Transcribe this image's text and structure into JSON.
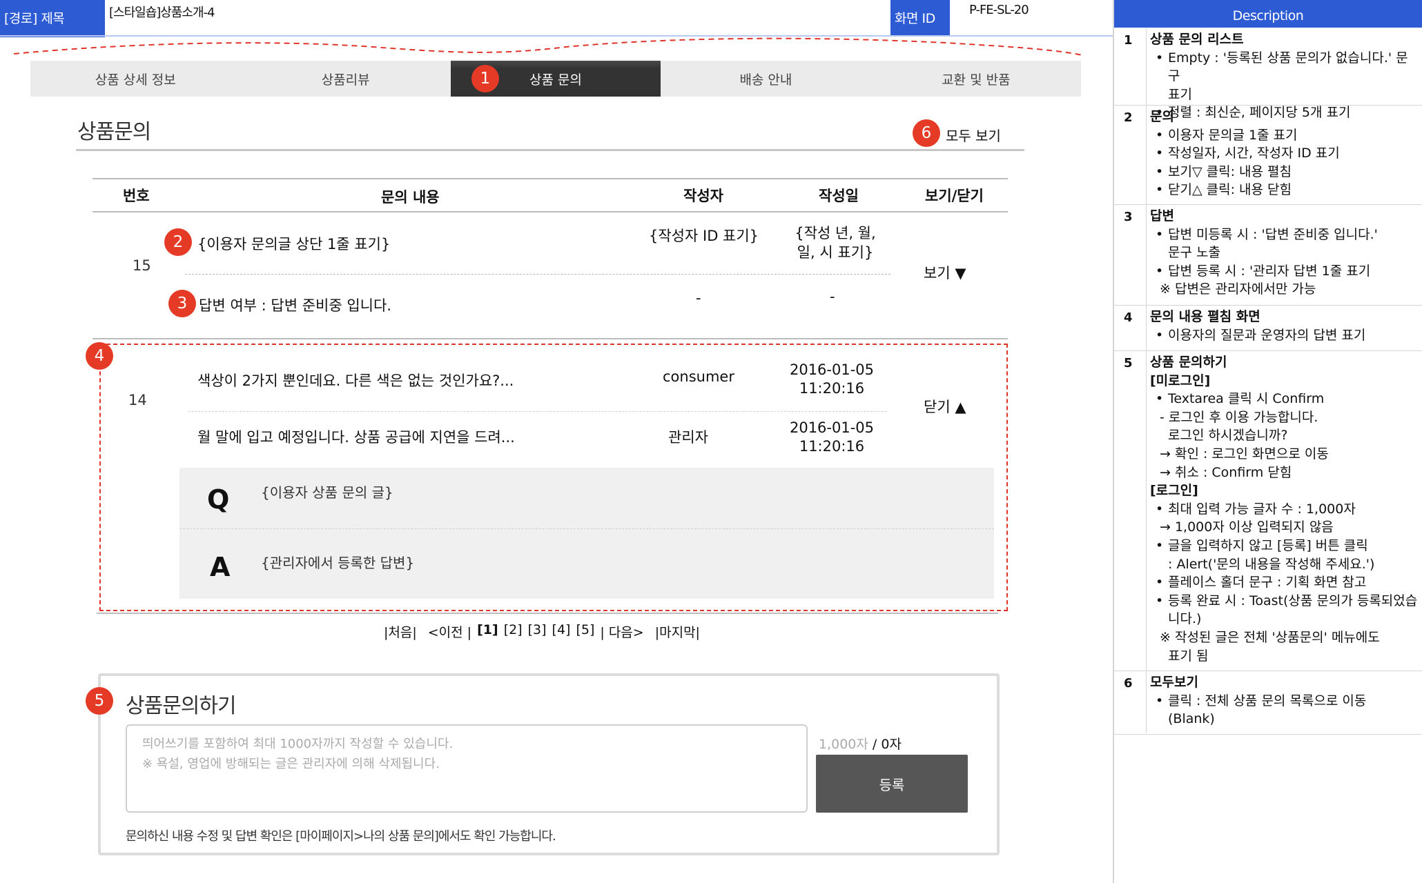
{
  "header": {
    "route_label": "[경로] 제목",
    "route_value": "[스타일숍]상품소개-4",
    "screen_id_label": "화면 ID",
    "screen_id_value": "P-FE-SL-20"
  },
  "tabs": [
    {
      "label": "상품 상세 정보"
    },
    {
      "label": "상품리뷰"
    },
    {
      "label": "상품 문의"
    },
    {
      "label": "배송 안내"
    },
    {
      "label": "교환 및 반품"
    }
  ],
  "badges": [
    "1",
    "2",
    "3",
    "4",
    "5",
    "6"
  ],
  "inquiry": {
    "title": "상품문의",
    "view_all": "모두 보기",
    "columns": [
      "번호",
      "문의 내용",
      "작성자",
      "작성일",
      "보기/닫기"
    ],
    "row15": {
      "num": "15",
      "question": "{이용자 문의글 상단 1줄 표기}",
      "author": "{작성자 ID 표기}",
      "date_line1": "{작성 년, 월,",
      "date_line2": "일, 시 표기}",
      "answer": "답변 여부 : 답변 준비중 입니다.",
      "answer_author": "-",
      "answer_date": "-",
      "toggle": "보기 ▼"
    },
    "row14": {
      "num": "14",
      "question": "색상이 2가지 뿐인데요. 다른 색은 없는 것인가요?...",
      "author": "consumer",
      "date": "2016-01-05",
      "time": "11:20:16",
      "answer": "월 말에 입고 예정입니다. 상품 공급에 지연을 드려...",
      "answer_author": "관리자",
      "answer_date": "2016-01-05",
      "answer_time": "11:20:16",
      "toggle": "닫기 ▲",
      "q_mark": "Q",
      "q_text": "{이용자 상품 문의 글}",
      "a_mark": "A",
      "a_text": "{관리자에서 등록한 답변}"
    },
    "pagination": {
      "first": "|처음|",
      "prev": "<이전 |",
      "pages": [
        "[1]",
        "[2]",
        "[3]",
        "[4]",
        "[5]"
      ],
      "next": "| 다음>",
      "last": "|마지막|"
    }
  },
  "write": {
    "title": "상품문의하기",
    "placeholder_line1": "띄어쓰기를 포함하여 최대 1000자까지 작성할 수 있습니다.",
    "placeholder_line2": "※ 욕설, 영업에 방해되는 글은 관리자에 의해 삭제됩니다.",
    "counter_max": "1,000자",
    "counter_current": " / 0자",
    "submit": "등록",
    "notice": "문의하신 내용 수정 및 답변 확인은 [마이페이지>나의 상품 문의]에서도 확인 가능합니다."
  },
  "description": {
    "title": "Description",
    "items": [
      {
        "num": "1",
        "lines": [
          {
            "k": "t",
            "v": "상품 문의 리스트"
          },
          {
            "k": "li",
            "v": "Empty : '등록된 상품 문의가 없습니다.' 문구"
          },
          {
            "k": "ind",
            "v": "표기"
          },
          {
            "k": "li",
            "v": "정렬 : 최신순, 페이지당 5개 표기"
          }
        ]
      },
      {
        "num": "2",
        "lines": [
          {
            "k": "t",
            "v": "문의"
          },
          {
            "k": "li",
            "v": "이용자 문의글 1줄 표기"
          },
          {
            "k": "li",
            "v": "작성일자, 시간, 작성자 ID 표기"
          },
          {
            "k": "li",
            "v": "보기▽ 클릭: 내용 펼침"
          },
          {
            "k": "li",
            "v": "닫기△ 클릭: 내용 닫힘"
          }
        ]
      },
      {
        "num": "3",
        "lines": [
          {
            "k": "t",
            "v": "답변"
          },
          {
            "k": "li",
            "v": "답변 미등록 시 : '답변 준비중 입니다.'"
          },
          {
            "k": "ind",
            "v": "문구 노출"
          },
          {
            "k": "li",
            "v": "답변 등록 시 : '관리자 답변 1줄 표기"
          },
          {
            "k": "ind2",
            "v": "※ 답변은 관리자에서만 가능"
          }
        ]
      },
      {
        "num": "4",
        "lines": [
          {
            "k": "t",
            "v": "문의 내용 펼침 화면"
          },
          {
            "k": "li",
            "v": "이용자의 질문과 운영자의 답변 표기"
          }
        ]
      },
      {
        "num": "5",
        "lines": [
          {
            "k": "t",
            "v": "상품 문의하기"
          },
          {
            "k": "t",
            "v": "[미로그인]"
          },
          {
            "k": "li",
            "v": "Textarea 클릭 시 Confirm"
          },
          {
            "k": "ind2",
            "v": "- 로그인 후 이용 가능합니다."
          },
          {
            "k": "ind",
            "v": "로그인 하시겠습니까?"
          },
          {
            "k": "ind2",
            "v": "→ 확인 : 로그인 화면으로 이동"
          },
          {
            "k": "ind2",
            "v": "→ 취소 : Confirm 닫힘"
          },
          {
            "k": "t",
            "v": "[로그인]"
          },
          {
            "k": "li",
            "v": "최대 입력 가능 글자 수 : 1,000자"
          },
          {
            "k": "ind2",
            "v": "→ 1,000자 이상 입력되지 않음"
          },
          {
            "k": "li",
            "v": "글을 입력하지 않고 [등록] 버튼 클릭"
          },
          {
            "k": "ind",
            "v": ": Alert('문의 내용을 작성해 주세요.')"
          },
          {
            "k": "li",
            "v": "플레이스 홀더 문구 : 기획 화면 참고"
          },
          {
            "k": "li",
            "v": "등록 완료 시 : Toast(상품 문의가 등록되었습"
          },
          {
            "k": "ind",
            "v": "니다.)"
          },
          {
            "k": "ind2",
            "v": "※ 작성된 글은 전체 '상품문의' 메뉴에도"
          },
          {
            "k": "ind",
            "v": "표기 됨"
          }
        ]
      },
      {
        "num": "6",
        "lines": [
          {
            "k": "t",
            "v": "모두보기"
          },
          {
            "k": "li",
            "v": "클릭 : 전체 상품 문의 목록으로 이동"
          },
          {
            "k": "ind",
            "v": "(Blank)"
          }
        ]
      }
    ]
  }
}
